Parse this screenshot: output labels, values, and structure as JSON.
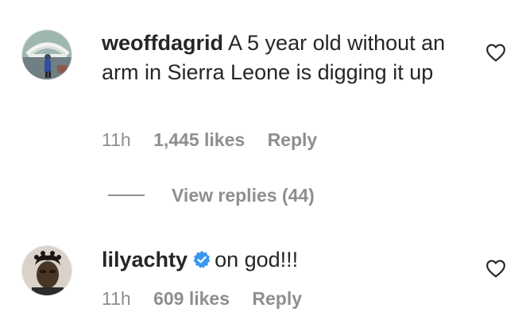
{
  "comments": [
    {
      "username": "weoffdagrid",
      "text": "A 5 year old without an arm in Sierra Leone is digging it up",
      "time": "11h",
      "likes": "1,445 likes",
      "reply_label": "Reply",
      "verified": false,
      "avatar_icon": "avatar-photo-weoffdagrid",
      "like_icon": "heart-outline-icon"
    },
    {
      "username": "lilyachty",
      "text": "on god!!!",
      "time": "11h",
      "likes": "609 likes",
      "reply_label": "Reply",
      "verified": true,
      "avatar_icon": "avatar-photo-lilyachty",
      "like_icon": "heart-outline-icon"
    }
  ],
  "view_replies": {
    "label": "View replies (44)"
  },
  "colors": {
    "primary_text": "#262626",
    "secondary_text": "#8e8e8e",
    "verified_blue": "#3897f0",
    "background": "#ffffff"
  }
}
